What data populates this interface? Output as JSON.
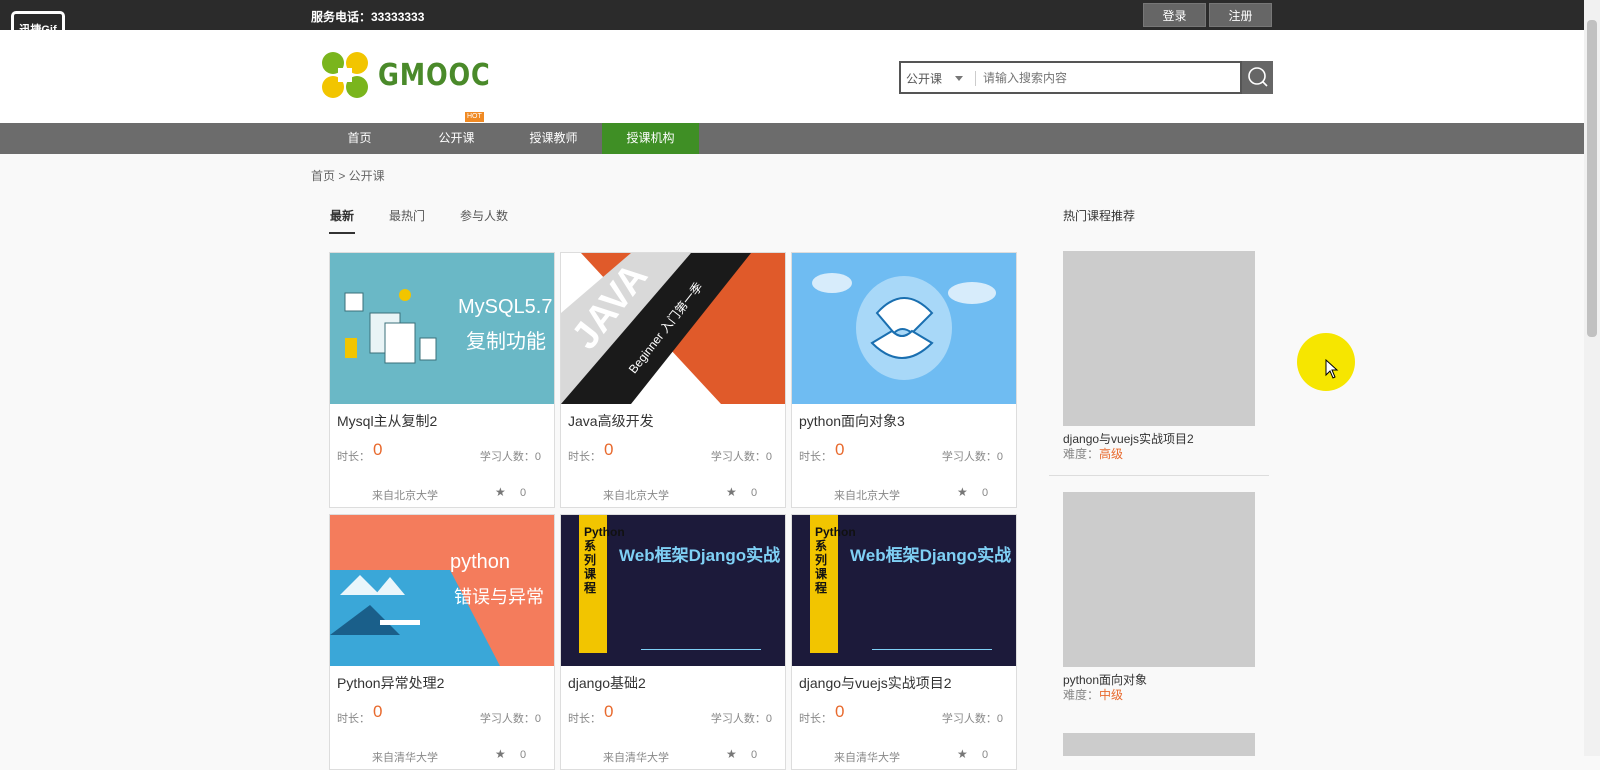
{
  "topbar": {
    "gif_badge": "迅捷Gif",
    "phone": "服务电话：33333333",
    "login": "登录",
    "register": "注册"
  },
  "header": {
    "logo_text": "GMOOC",
    "search": {
      "category": "公开课",
      "placeholder": "请输入搜索内容"
    }
  },
  "nav": {
    "items": [
      "首页",
      "公开课",
      "授课教师",
      "授课机构"
    ],
    "active_index": 3,
    "hot_badge": "HOT"
  },
  "breadcrumb": "首页 > 公开课",
  "tabs": [
    "最新",
    "最热门",
    "参与人数"
  ],
  "labels": {
    "duration": "时长：",
    "learners": "学习人数：0"
  },
  "courses": [
    {
      "title": "Mysql主从复制2",
      "duration": "0",
      "school": "来自北京大学",
      "favs": "0",
      "thumb_text_1": "MySQL5.7",
      "thumb_text_2": "复制功能"
    },
    {
      "title": "Java高级开发",
      "duration": "0",
      "school": "来自北京大学",
      "favs": "0",
      "thumb_text_1": "JAVA",
      "thumb_text_2": "Beginner 入门第一季"
    },
    {
      "title": "python面向对象3",
      "duration": "0",
      "school": "来自北京大学",
      "favs": "0"
    },
    {
      "title": "Python异常处理2",
      "duration": "0",
      "school": "来自清华大学",
      "favs": "0",
      "thumb_text_1": "python",
      "thumb_text_2": "错误与异常"
    },
    {
      "title": "django基础2",
      "duration": "0",
      "school": "来自清华大学",
      "favs": "0",
      "thumb_text_1": "Web框架Django实战",
      "thumb_text_2": "Python系列课程"
    },
    {
      "title": "django与vuejs实战项目2",
      "duration": "0",
      "school": "来自清华大学",
      "favs": "0",
      "thumb_text_1": "Web框架Django实战",
      "thumb_text_2": "Python系列课程"
    }
  ],
  "sidebar": {
    "title": "热门课程推荐",
    "level_label": "难度：",
    "items": [
      {
        "name": "django与vuejs实战项目2",
        "level": "高级"
      },
      {
        "name": "python面向对象",
        "level": "中级"
      }
    ]
  },
  "colors": {
    "accent_green": "#3f8f25",
    "orange": "#e86a2e",
    "topbar": "#2b2b2b",
    "nav": "#6c6c6c"
  }
}
